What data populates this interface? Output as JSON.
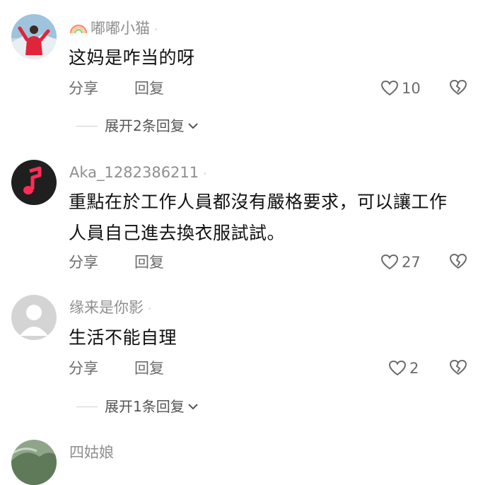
{
  "comments": [
    {
      "username": "嘟嘟小猫",
      "username_badge": "rainbow-icon",
      "content_lines": [
        "这妈是咋当的呀"
      ],
      "share_label": "分享",
      "reply_label": "回复",
      "likes": "10",
      "expand_label": "展开2条回复"
    },
    {
      "username": "Aka_1282386211",
      "content_lines": [
        "重點在於工作人員都沒有嚴格要求，可以讓工作",
        "人員自己進去換衣服試試。"
      ],
      "share_label": "分享",
      "reply_label": "回复",
      "likes": "27"
    },
    {
      "username": "缘来是你影",
      "content_lines": [
        "生活不能自理"
      ],
      "share_label": "分享",
      "reply_label": "回复",
      "likes": "2",
      "expand_label": "展开1条回复"
    },
    {
      "username": "四姑娘"
    }
  ],
  "icons": {
    "like": "heart-outline-icon",
    "dislike": "broken-heart-icon",
    "expand": "chevron-down-icon"
  },
  "colors": {
    "text_primary": "#111111",
    "text_secondary": "#8f8f8f",
    "action_text": "#6c6c6c",
    "music_avatar_bg": "#1f1f1f",
    "music_note": "#ff2d55"
  }
}
